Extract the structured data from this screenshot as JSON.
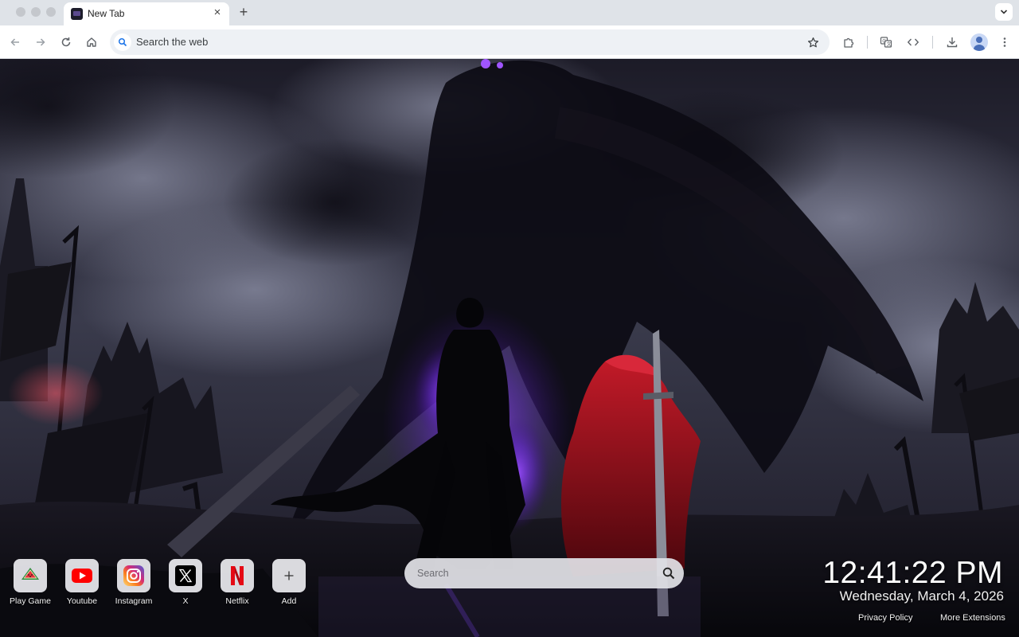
{
  "browser": {
    "tab": {
      "title": "New Tab"
    },
    "omnibox": {
      "placeholder": "Search the web"
    }
  },
  "shortcuts": [
    {
      "label": "Play Game",
      "icon": "watermelon-icon"
    },
    {
      "label": "Youtube",
      "icon": "youtube-icon"
    },
    {
      "label": "Instagram",
      "icon": "instagram-icon"
    },
    {
      "label": "X",
      "icon": "x-logo-icon"
    },
    {
      "label": "Netflix",
      "icon": "netflix-icon"
    },
    {
      "label": "Add",
      "icon": "plus-icon"
    }
  ],
  "search": {
    "placeholder": "Search"
  },
  "clock": {
    "time": "12:41:22 PM",
    "date": "Wednesday, March 4, 2026"
  },
  "footer": {
    "privacy": "Privacy Policy",
    "more": "More Extensions"
  },
  "colors": {
    "youtube": "#ff0000",
    "netflix": "#e50914",
    "aura": "#8a3cff",
    "knight": "#a8141e"
  }
}
